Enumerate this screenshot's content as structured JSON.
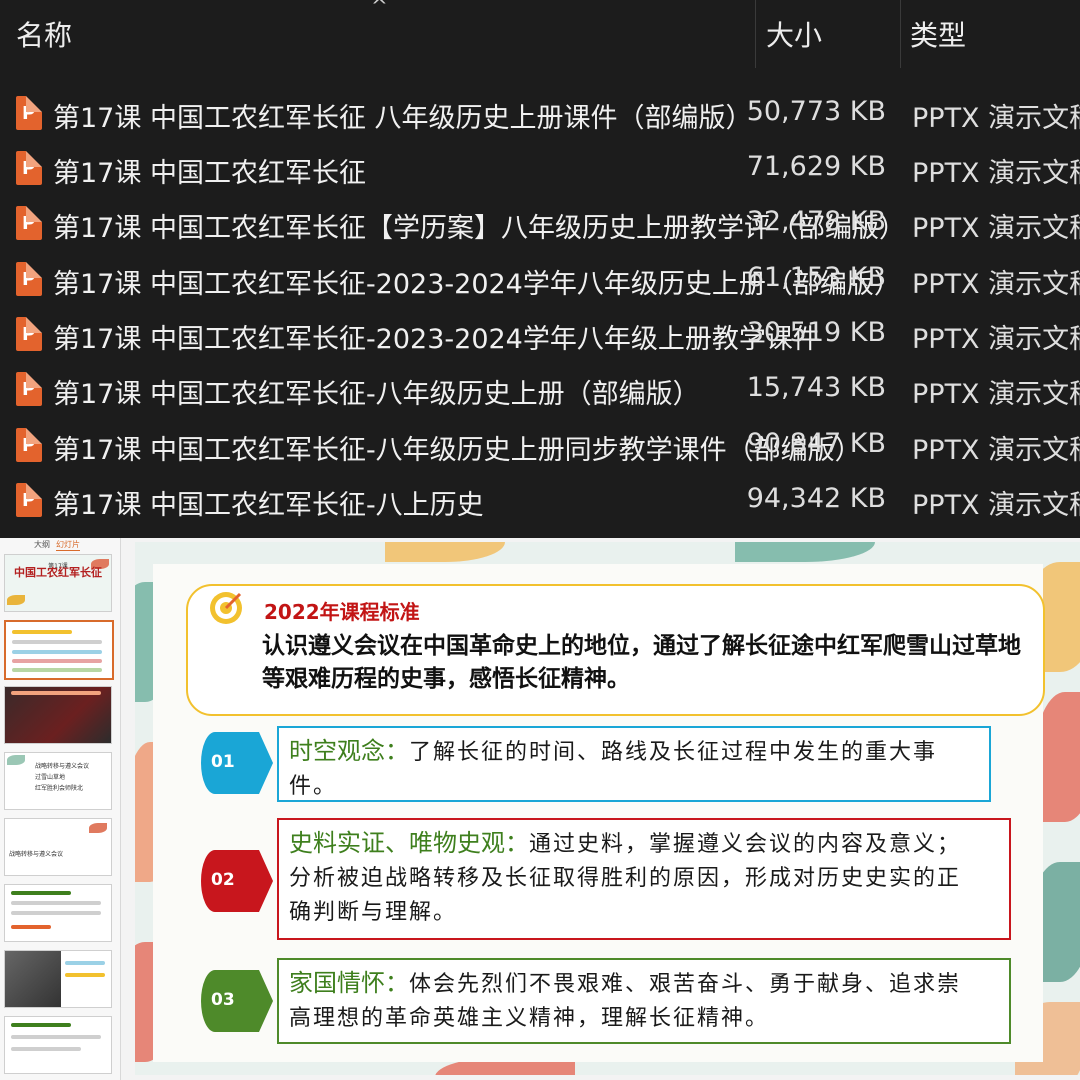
{
  "explorer": {
    "columns": {
      "name": "名称",
      "size": "大小",
      "type": "类型"
    },
    "sort_indicator": "^",
    "files": [
      {
        "name": "第17课 中国工农红军长征 八年级历史上册课件（部编版）",
        "size": "50,773 KB",
        "type": "PPTX 演示文稿"
      },
      {
        "name": "第17课 中国工农红军长征",
        "size": "71,629 KB",
        "type": "PPTX 演示文稿"
      },
      {
        "name": "第17课 中国工农红军长征【学历案】八年级历史上册教学评（部编版）",
        "size": "32,478 KB",
        "type": "PPTX 演示文稿"
      },
      {
        "name": "第17课 中国工农红军长征-2023-2024学年八年级历史上册（部编版）",
        "size": "61,153 KB",
        "type": "PPTX 演示文稿"
      },
      {
        "name": "第17课 中国工农红军长征-2023-2024学年八年级上册教学课件",
        "size": "30,519 KB",
        "type": "PPTX 演示文稿"
      },
      {
        "name": "第17课 中国工农红军长征-八年级历史上册（部编版）",
        "size": "15,743 KB",
        "type": "PPTX 演示文稿"
      },
      {
        "name": "第17课 中国工农红军长征-八年级历史上册同步教学课件（部编版）",
        "size": "90,847 KB",
        "type": "PPTX 演示文稿"
      },
      {
        "name": "第17课 中国工农红军长征-八上历史",
        "size": "94,342 KB",
        "type": "PPTX 演示文稿"
      }
    ],
    "file_icon_letter": "P",
    "icon_color": "#e3632d"
  },
  "ppt": {
    "panel_tabs": [
      "大纲",
      "幻灯片"
    ],
    "thumbs": {
      "t1_small": "第17课",
      "t1_title": "中国工农红军长征",
      "t5_label": "战略转移与遵义会议",
      "t4_items": [
        "战略转移与遵义会议",
        "过雪山草地",
        "红军胜利会师陕北"
      ]
    },
    "slide": {
      "standard_title": "2022年课程标准",
      "standard_body": "认识遵义会议在中国革命史上的地位，通过了解长征途中红军爬雪山过草地等艰难历程的史事，感悟长征精神。",
      "points": [
        {
          "num": "01",
          "keyword": "时空观念：",
          "text": "了解长征的时间、路线及长征过程中发生的重大事件。",
          "color": "#1aa6d6"
        },
        {
          "num": "02",
          "keyword": "史料实证、唯物史观：",
          "text": "通过史料，掌握遵义会议的内容及意义；分析被迫战略转移及长征取得胜利的原因，形成对历史史实的正确判断与理解。",
          "color": "#c8161d"
        },
        {
          "num": "03",
          "keyword": "家国情怀：",
          "text": "体会先烈们不畏艰难、艰苦奋斗、勇于献身、追求崇高理想的革命英雄主义精神，理解长征精神。",
          "color": "#4e8a2a"
        }
      ],
      "keyword_color": "#3e7f1d",
      "accent_yellow": "#f2c12e"
    }
  }
}
